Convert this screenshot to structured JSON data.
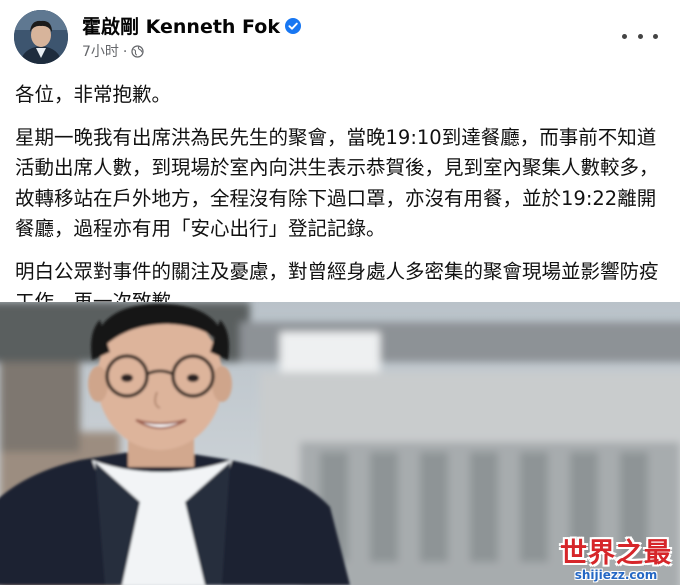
{
  "post": {
    "author_name": "霍啟剛 Kenneth Fok",
    "verified_badge": "verified-icon",
    "time": "7小时",
    "audience_icon": "globe-icon",
    "more_icon": "more-icon",
    "paragraphs": [
      "各位，非常抱歉。",
      "星期一晚我有出席洪為民先生的聚會，當晚19:10到達餐廳，而事前不知道活動出席人數，到現場於室內向洪生表示恭賀後，見到室內聚集人數較多，故轉移站在戶外地方，全程沒有除下過口罩，亦沒有用餐，並於19:22離開餐廳，過程亦有用「安心出行」登記記錄。",
      "明白公眾對事件的關注及憂慮，對曾經身處人多密集的聚會現場並影響防疫工作，再一次致歉。"
    ]
  },
  "watermark": {
    "main": "世界之最",
    "sub": "shijiezz.com"
  },
  "colors": {
    "verified_blue": "#1877f2",
    "meta_gray": "#65676b",
    "watermark_red": "#d6262a",
    "watermark_blue": "#2467c4"
  }
}
